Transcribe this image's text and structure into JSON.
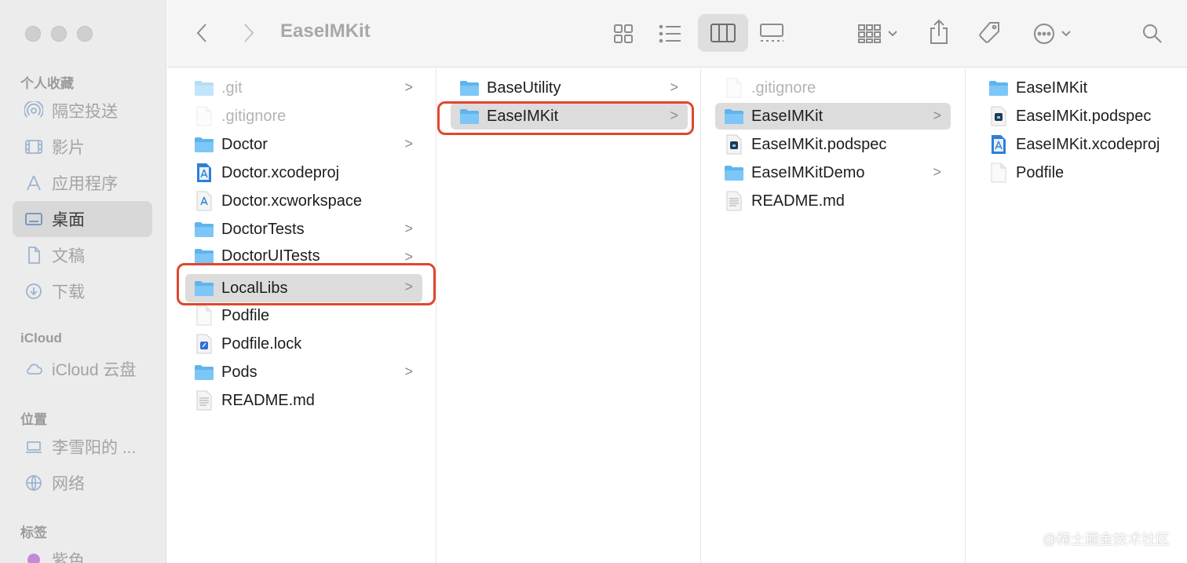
{
  "window": {
    "title": "EaseIMKit"
  },
  "sidebar": {
    "sections": [
      {
        "label": "个人收藏"
      },
      {
        "label": "iCloud"
      },
      {
        "label": "位置"
      },
      {
        "label": "标签"
      }
    ],
    "items": [
      {
        "label": "隔空投送",
        "icon": "airdrop-icon"
      },
      {
        "label": "影片",
        "icon": "film-icon"
      },
      {
        "label": "应用程序",
        "icon": "applications-icon"
      },
      {
        "label": "桌面",
        "icon": "desktop-icon"
      },
      {
        "label": "文稿",
        "icon": "document-icon"
      },
      {
        "label": "下载",
        "icon": "download-icon"
      },
      {
        "label": "iCloud 云盘",
        "icon": "cloud-icon"
      },
      {
        "label": "李雪阳的 ...",
        "icon": "laptop-icon"
      },
      {
        "label": "网络",
        "icon": "globe-icon"
      },
      {
        "label": "紫色",
        "icon": "purple-tag-icon"
      }
    ]
  },
  "columns": [
    {
      "items": [
        {
          "name": ".git",
          "type": "folder",
          "dim": true,
          "chevron": ">"
        },
        {
          "name": ".gitignore",
          "type": "file",
          "dim": true,
          "chevron": ""
        },
        {
          "name": "Doctor",
          "type": "folder",
          "dim": false,
          "chevron": ">"
        },
        {
          "name": "Doctor.xcodeproj",
          "type": "xcodeproj",
          "dim": false,
          "chevron": ""
        },
        {
          "name": "Doctor.xcworkspace",
          "type": "xcworkspace",
          "dim": false,
          "chevron": ""
        },
        {
          "name": "DoctorTests",
          "type": "folder",
          "dim": false,
          "chevron": ">"
        },
        {
          "name": "DoctorUITests",
          "type": "folder",
          "dim": false,
          "chevron": ">"
        },
        {
          "name": "LocalLibs",
          "type": "folder",
          "dim": false,
          "chevron": ">"
        },
        {
          "name": "Podfile",
          "type": "file",
          "dim": false,
          "chevron": ""
        },
        {
          "name": "Podfile.lock",
          "type": "lock",
          "dim": false,
          "chevron": ""
        },
        {
          "name": "Pods",
          "type": "folder",
          "dim": false,
          "chevron": ">"
        },
        {
          "name": "README.md",
          "type": "text",
          "dim": false,
          "chevron": ""
        }
      ]
    },
    {
      "items": [
        {
          "name": "BaseUtility",
          "type": "folder",
          "dim": false,
          "chevron": ">"
        },
        {
          "name": "EaseIMKit",
          "type": "folder",
          "dim": false,
          "chevron": ">"
        }
      ]
    },
    {
      "items": [
        {
          "name": ".gitignore",
          "type": "file",
          "dim": true,
          "chevron": ""
        },
        {
          "name": "EaseIMKit",
          "type": "folder",
          "dim": false,
          "chevron": ">"
        },
        {
          "name": "EaseIMKit.podspec",
          "type": "podspec",
          "dim": false,
          "chevron": ""
        },
        {
          "name": "EaseIMKitDemo",
          "type": "folder",
          "dim": false,
          "chevron": ">"
        },
        {
          "name": "README.md",
          "type": "text",
          "dim": false,
          "chevron": ""
        }
      ]
    },
    {
      "items": [
        {
          "name": "EaseIMKit",
          "type": "folder",
          "dim": false,
          "chevron": ""
        },
        {
          "name": "EaseIMKit.podspec",
          "type": "podspec",
          "dim": false,
          "chevron": ""
        },
        {
          "name": "EaseIMKit.xcodeproj",
          "type": "xcodeproj",
          "dim": false,
          "chevron": ""
        },
        {
          "name": "Podfile",
          "type": "file",
          "dim": false,
          "chevron": ""
        }
      ]
    }
  ],
  "selection": {
    "column1": "LocalLibs",
    "column2": "EaseIMKit",
    "column3": "EaseIMKit"
  },
  "highlight_color": "#e0472d",
  "watermark": "@稀土掘金技术社区"
}
